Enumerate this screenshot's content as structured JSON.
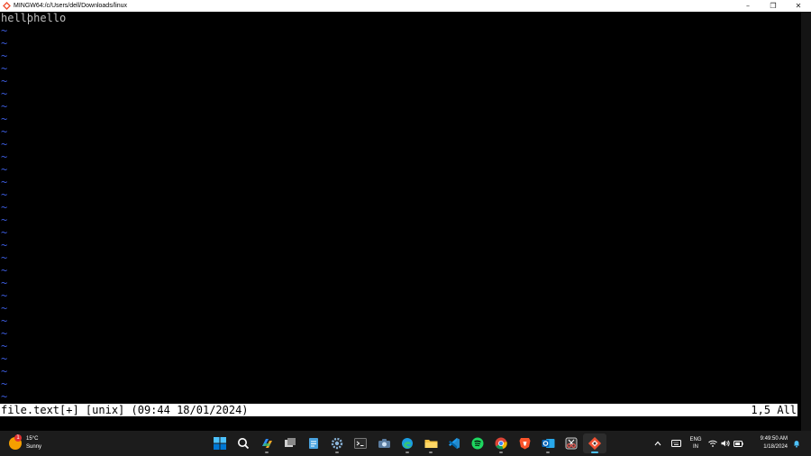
{
  "window": {
    "title": "MINGW64:/c/Users/dell/Downloads/linux",
    "minimize_glyph": "–",
    "restore_glyph": "❐",
    "close_glyph": "✕"
  },
  "editor": {
    "content_line": "hellohello",
    "empty_line_marker": "~",
    "cursor_line": 1,
    "cursor_column": 5,
    "status_left": "file.text[+] [unix] (09:44 18/01/2024)",
    "status_right": "1,5 All"
  },
  "colors": {
    "background": "#000000",
    "text": "#bfbfbf",
    "tilde": "#3b5bdb",
    "status_bg": "#ffffff",
    "taskbar": "#1c1c1c"
  },
  "taskbar": {
    "weather": {
      "badge": "1",
      "temperature": "15°C",
      "condition": "Sunny"
    },
    "apps": [
      {
        "name": "start",
        "icon": "windows-start-icon"
      },
      {
        "name": "search",
        "icon": "search-icon"
      },
      {
        "name": "copilot",
        "icon": "copilot-icon"
      },
      {
        "name": "task-view",
        "icon": "task-view-icon"
      },
      {
        "name": "notepad",
        "icon": "notepad-icon"
      },
      {
        "name": "settings",
        "icon": "gear-icon"
      },
      {
        "name": "terminal",
        "icon": "terminal-icon"
      },
      {
        "name": "camera",
        "icon": "camera-icon"
      },
      {
        "name": "edge",
        "icon": "edge-icon"
      },
      {
        "name": "file-explorer",
        "icon": "folder-icon"
      },
      {
        "name": "vscode",
        "icon": "vscode-icon"
      },
      {
        "name": "spotify",
        "icon": "spotify-icon"
      },
      {
        "name": "chrome",
        "icon": "chrome-icon"
      },
      {
        "name": "brave",
        "icon": "brave-icon"
      },
      {
        "name": "outlook",
        "icon": "outlook-icon"
      },
      {
        "name": "snipping-tool",
        "icon": "snipping-tool-icon"
      },
      {
        "name": "git-bash",
        "icon": "git-bash-icon"
      }
    ],
    "tray": {
      "language_top": "ENG",
      "language_bottom": "IN",
      "time": "9:49:50 AM",
      "date": "1/18/2024"
    }
  }
}
